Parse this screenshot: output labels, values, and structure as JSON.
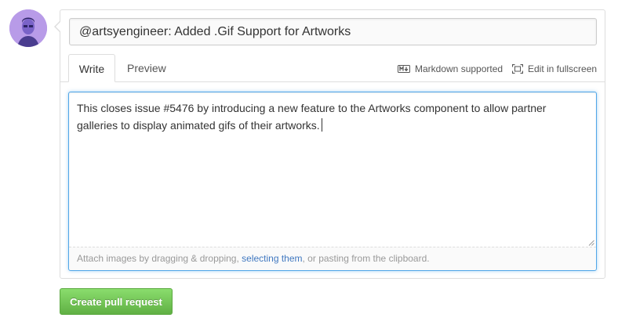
{
  "title_input": {
    "value": "@artsyengineer: Added .Gif Support for Artworks"
  },
  "tabs": [
    {
      "label": "Write",
      "active": true
    },
    {
      "label": "Preview",
      "active": false
    }
  ],
  "toolbar": {
    "markdown_label": "Markdown supported",
    "markdown_icon": "markdown-icon",
    "fullscreen_label": "Edit in fullscreen",
    "fullscreen_icon": "fullscreen-icon"
  },
  "editor": {
    "text": "This closes issue #5476 by introducing a new feature to the Artworks component to allow partner galleries to display animated gifs of their artworks."
  },
  "dropzone": {
    "prefix": "Attach images by dragging & dropping, ",
    "link": "selecting them",
    "suffix": ", or pasting from the clipboard."
  },
  "submit": {
    "label": "Create pull request"
  },
  "colors": {
    "accent_blue": "#51a7e8",
    "link": "#4078c0",
    "button_green": "#60b044",
    "avatar_bg": "#b89be8"
  }
}
